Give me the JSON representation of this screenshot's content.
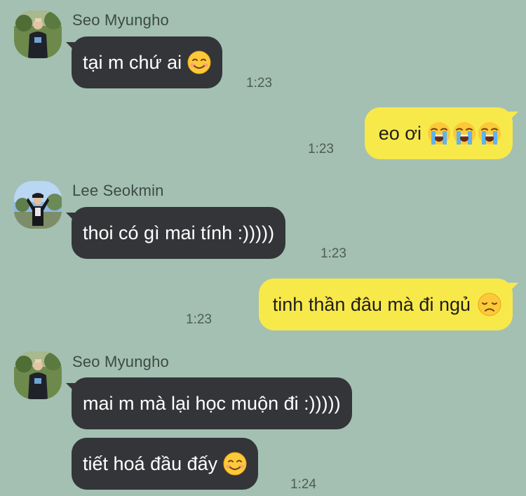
{
  "messages": [
    {
      "sender": "Seo Myungho",
      "text": "tại m chứ ai",
      "emoji": "smiling-face-icon",
      "time": "1:23"
    },
    {
      "text": "eo ơi",
      "emoji": "loudly-crying-face-icon",
      "time": "1:23"
    },
    {
      "sender": "Lee Seokmin",
      "text": "thoi có gì mai tính :)))))",
      "time": "1:23"
    },
    {
      "text": "tinh thần đâu mà đi ngủ",
      "emoji": "disappointed-face-icon",
      "time": "1:23"
    },
    {
      "sender": "Seo Myungho",
      "text": "mai m mà lại học muộn đi :)))))"
    },
    {
      "text": "tiết hoá đầu đấy",
      "emoji": "smiling-face-icon",
      "time": "1:24"
    }
  ],
  "colors": {
    "background": "#a3c0b3",
    "incoming_bubble": "#333538",
    "outgoing_bubble": "#f8e94a"
  }
}
